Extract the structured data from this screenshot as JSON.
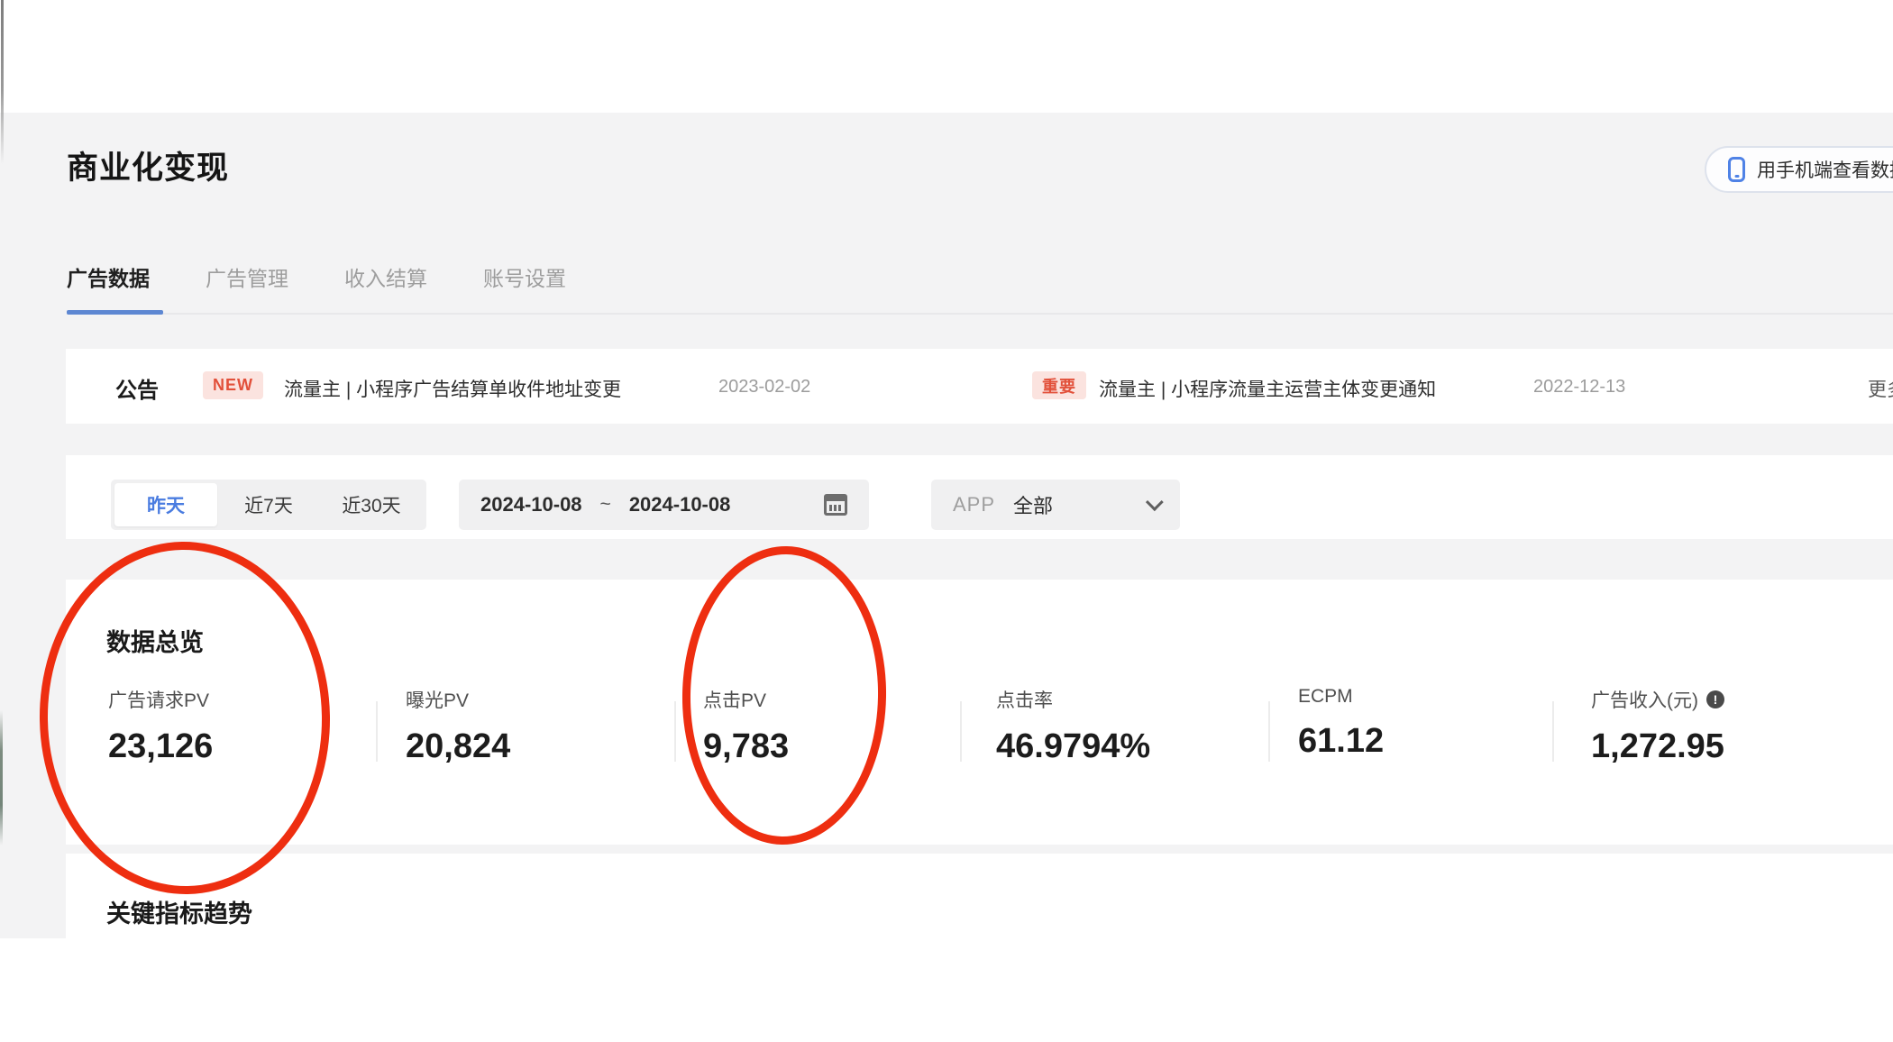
{
  "page_title": "商业化变现",
  "header": {
    "phone_button_label": "用手机端查看数据"
  },
  "tabs": {
    "active": "广告数据",
    "items": [
      {
        "label": "广告数据"
      },
      {
        "label": "广告管理"
      },
      {
        "label": "收入结算"
      },
      {
        "label": "账号设置"
      }
    ]
  },
  "announcement": {
    "title": "公告",
    "items": [
      {
        "badge": "NEW",
        "text": "流量主 | 小程序广告结算单收件地址变更",
        "date": "2023-02-02"
      },
      {
        "badge": "重要",
        "text": "流量主 | 小程序流量主运营主体变更通知",
        "date": "2022-12-13"
      }
    ],
    "more_label": "更多"
  },
  "filters": {
    "quick_ranges": [
      {
        "label": "昨天",
        "selected": true
      },
      {
        "label": "近7天",
        "selected": false
      },
      {
        "label": "近30天",
        "selected": false
      }
    ],
    "date_start": "2024-10-08",
    "date_separator": "~",
    "date_end": "2024-10-08",
    "app_label": "APP",
    "app_value": "全部",
    "calendar_icon": "calendar-icon",
    "dropdown_icon": "chevron-down-icon"
  },
  "overview": {
    "title": "数据总览",
    "metrics": [
      {
        "label": "广告请求PV",
        "value": "23,126"
      },
      {
        "label": "曝光PV",
        "value": "20,824"
      },
      {
        "label": "点击PV",
        "value": "9,783"
      },
      {
        "label": "点击率",
        "value": "46.9794%"
      },
      {
        "label": "ECPM",
        "value": "61.12"
      },
      {
        "label": "广告收入(元)",
        "value": "1,272.95",
        "info_icon": "!"
      }
    ]
  },
  "trend": {
    "title": "关键指标趋势"
  },
  "annotations": {
    "circled_metrics": [
      "广告请求PV",
      "点击PV"
    ],
    "circle_color": "#ee2e10"
  },
  "colors": {
    "accent_blue": "#4a7ce0",
    "tab_underline": "#5d87d2",
    "badge_bg": "#fbe3df",
    "badge_text": "#e2503a",
    "page_bg": "#f3f3f4",
    "card_bg": "#ffffff"
  }
}
